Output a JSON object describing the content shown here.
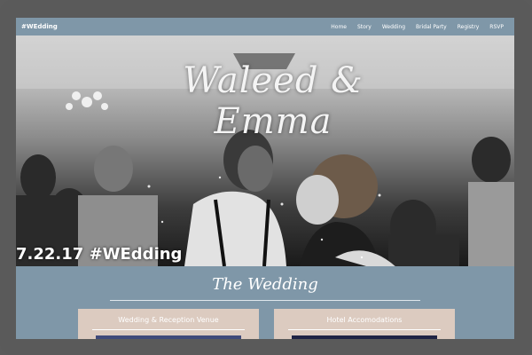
{
  "nav": {
    "brand": "#WEdding",
    "items": [
      {
        "label": "Home"
      },
      {
        "label": "Story"
      },
      {
        "label": "Wedding"
      },
      {
        "label": "Bridal Party"
      },
      {
        "label": "Registry"
      },
      {
        "label": "RSVP"
      }
    ]
  },
  "hero": {
    "names": "Waleed & Emma",
    "date_tag": "7.22.17 #WEdding"
  },
  "section": {
    "title": "The Wedding",
    "cards": [
      {
        "title": "Wedding & Reception Venue"
      },
      {
        "title": "Hotel Accomodations"
      }
    ]
  },
  "colors": {
    "nav_bg": "#7f97a8",
    "card_bg": "#dccbc0",
    "frame": "#5a5a5a"
  }
}
